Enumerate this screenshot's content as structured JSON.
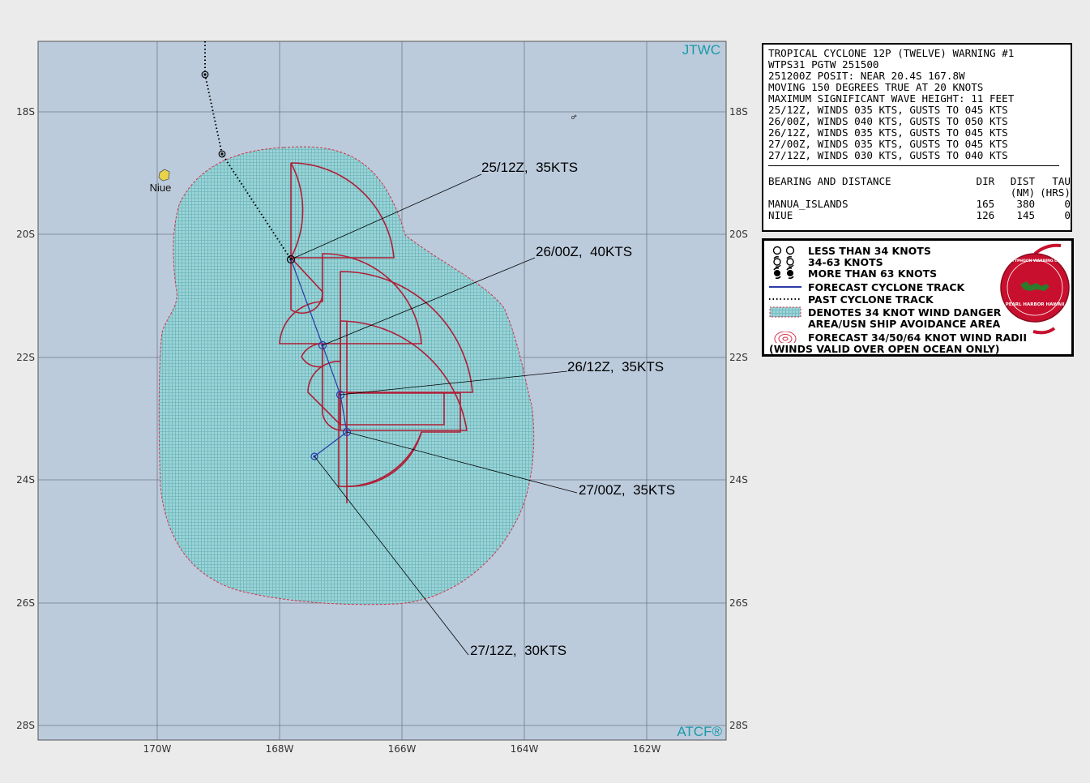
{
  "map": {
    "brand_top": "JTWC",
    "brand_bottom": "ATCF®",
    "lat_labels": [
      "18S",
      "20S",
      "22S",
      "24S",
      "26S",
      "28S"
    ],
    "lon_labels": [
      "170W",
      "168W",
      "166W",
      "164W",
      "162W"
    ],
    "island_label": "Niue",
    "forecast_labels": [
      "25/12Z,  35KTS",
      "26/00Z,  40KTS",
      "26/12Z,  35KTS",
      "27/00Z,  35KTS",
      "27/12Z,  30KTS"
    ]
  },
  "warning": {
    "lines": [
      "TROPICAL CYCLONE 12P (TWELVE) WARNING #1",
      "WTPS31 PGTW 251500",
      "251200Z POSIT: NEAR 20.4S 167.8W",
      "MOVING 150 DEGREES TRUE AT 20 KNOTS",
      "MAXIMUM SIGNIFICANT WAVE HEIGHT: 11 FEET",
      "25/12Z, WINDS 035 KTS, GUSTS TO 045 KTS",
      "26/00Z, WINDS 040 KTS, GUSTS TO 050 KTS",
      "26/12Z, WINDS 035 KTS, GUSTS TO 045 KTS",
      "27/00Z, WINDS 035 KTS, GUSTS TO 045 KTS",
      "27/12Z, WINDS 030 KTS, GUSTS TO 040 KTS"
    ],
    "bearing_header": {
      "title": "BEARING AND DISTANCE",
      "dir": "DIR",
      "dist": "DIST",
      "tau": "TAU",
      "dist_unit": "(NM)",
      "tau_unit": "(HRS)"
    },
    "bearing_rows": [
      {
        "name": "MANUA_ISLANDS",
        "dir": "165",
        "dist": "380",
        "tau": "0"
      },
      {
        "name": "NIUE",
        "dir": "126",
        "dist": "145",
        "tau": "0"
      }
    ]
  },
  "legend": {
    "items": [
      "LESS THAN 34 KNOTS",
      "34-63 KNOTS",
      "MORE THAN 63 KNOTS",
      "FORECAST CYCLONE TRACK",
      "PAST CYCLONE TRACK",
      "DENOTES 34 KNOT WIND DANGER",
      "AREA/USN SHIP AVOIDANCE AREA",
      "FORECAST 34/50/64 KNOT WIND RADII",
      "(WINDS VALID OVER OPEN OCEAN ONLY)"
    ],
    "seal_text": "JOINT TYPHOON WARNING CENTER",
    "seal_location": "PEARL HARBOR HAWAII"
  }
}
